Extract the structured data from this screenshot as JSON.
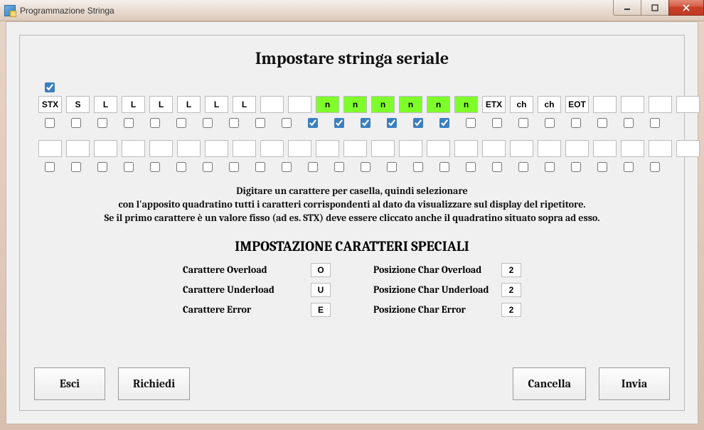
{
  "window": {
    "title": "Programmazione Stringa"
  },
  "main_title": "Impostare stringa seriale",
  "rows": [
    {
      "show_top_check": true,
      "cells": [
        {
          "value": "STX",
          "top_checked": true,
          "bot_checked": false,
          "highlight": false
        },
        {
          "value": "S",
          "top_checked": false,
          "bot_checked": false,
          "highlight": false
        },
        {
          "value": "L",
          "top_checked": false,
          "bot_checked": false,
          "highlight": false
        },
        {
          "value": "L",
          "top_checked": false,
          "bot_checked": false,
          "highlight": false
        },
        {
          "value": "L",
          "top_checked": false,
          "bot_checked": false,
          "highlight": false
        },
        {
          "value": "L",
          "top_checked": false,
          "bot_checked": false,
          "highlight": false
        },
        {
          "value": "L",
          "top_checked": false,
          "bot_checked": false,
          "highlight": false
        },
        {
          "value": "L",
          "top_checked": false,
          "bot_checked": false,
          "highlight": false
        },
        {
          "value": "",
          "top_checked": false,
          "bot_checked": false,
          "highlight": false
        },
        {
          "value": "",
          "top_checked": false,
          "bot_checked": false,
          "highlight": false
        },
        {
          "value": "n",
          "top_checked": false,
          "bot_checked": true,
          "highlight": true
        },
        {
          "value": "n",
          "top_checked": false,
          "bot_checked": true,
          "highlight": true
        },
        {
          "value": "n",
          "top_checked": false,
          "bot_checked": true,
          "highlight": true
        },
        {
          "value": "n",
          "top_checked": false,
          "bot_checked": true,
          "highlight": true
        },
        {
          "value": "n",
          "top_checked": false,
          "bot_checked": true,
          "highlight": true
        },
        {
          "value": "n",
          "top_checked": false,
          "bot_checked": true,
          "highlight": true
        },
        {
          "value": "ETX",
          "top_checked": false,
          "bot_checked": false,
          "highlight": false
        },
        {
          "value": "ch",
          "top_checked": false,
          "bot_checked": false,
          "highlight": false
        },
        {
          "value": "ch",
          "top_checked": false,
          "bot_checked": false,
          "highlight": false
        },
        {
          "value": "EOT",
          "top_checked": false,
          "bot_checked": false,
          "highlight": false
        },
        {
          "value": "",
          "top_checked": false,
          "bot_checked": false,
          "highlight": false
        },
        {
          "value": "",
          "top_checked": false,
          "bot_checked": false,
          "highlight": false
        },
        {
          "value": "",
          "top_checked": false,
          "bot_checked": false,
          "highlight": false
        },
        {
          "value": "",
          "top_checked": false,
          "bot_checked": false,
          "highlight": false
        }
      ]
    },
    {
      "show_top_check": false,
      "cells": [
        {
          "value": "",
          "bot_checked": false
        },
        {
          "value": "",
          "bot_checked": false
        },
        {
          "value": "",
          "bot_checked": false
        },
        {
          "value": "",
          "bot_checked": false
        },
        {
          "value": "",
          "bot_checked": false
        },
        {
          "value": "",
          "bot_checked": false
        },
        {
          "value": "",
          "bot_checked": false
        },
        {
          "value": "",
          "bot_checked": false
        },
        {
          "value": "",
          "bot_checked": false
        },
        {
          "value": "",
          "bot_checked": false
        },
        {
          "value": "",
          "bot_checked": false
        },
        {
          "value": "",
          "bot_checked": false
        },
        {
          "value": "",
          "bot_checked": false
        },
        {
          "value": "",
          "bot_checked": false
        },
        {
          "value": "",
          "bot_checked": false
        },
        {
          "value": "",
          "bot_checked": false
        },
        {
          "value": "",
          "bot_checked": false
        },
        {
          "value": "",
          "bot_checked": false
        },
        {
          "value": "",
          "bot_checked": false
        },
        {
          "value": "",
          "bot_checked": false
        },
        {
          "value": "",
          "bot_checked": false
        },
        {
          "value": "",
          "bot_checked": false
        },
        {
          "value": "",
          "bot_checked": false
        },
        {
          "value": "",
          "bot_checked": false
        }
      ]
    }
  ],
  "instructions": {
    "line1": "Digitare un carattere per casella,  quindi selezionare",
    "line2": "con l'apposito quadratino tutti i caratteri corrispondenti al dato da visualizzare sul display del ripetitore.",
    "line3": "Se il primo carattere è un valore fisso (ad es. STX) deve essere cliccato anche il quadratino situato sopra ad esso."
  },
  "special": {
    "title": "IMPOSTAZIONE CARATTERI SPECIALI",
    "left": [
      {
        "label": "Carattere Overload",
        "value": "O"
      },
      {
        "label": "Carattere Underload",
        "value": "U"
      },
      {
        "label": "Carattere Error",
        "value": "E"
      }
    ],
    "right": [
      {
        "label": "Posizione Char Overload",
        "value": "2"
      },
      {
        "label": "Posizione Char Underload",
        "value": "2"
      },
      {
        "label": "Posizione Char Error",
        "value": "2"
      }
    ]
  },
  "buttons": {
    "esci": "Esci",
    "richiedi": "Richiedi",
    "cancella": "Cancella",
    "invia": "Invia"
  }
}
